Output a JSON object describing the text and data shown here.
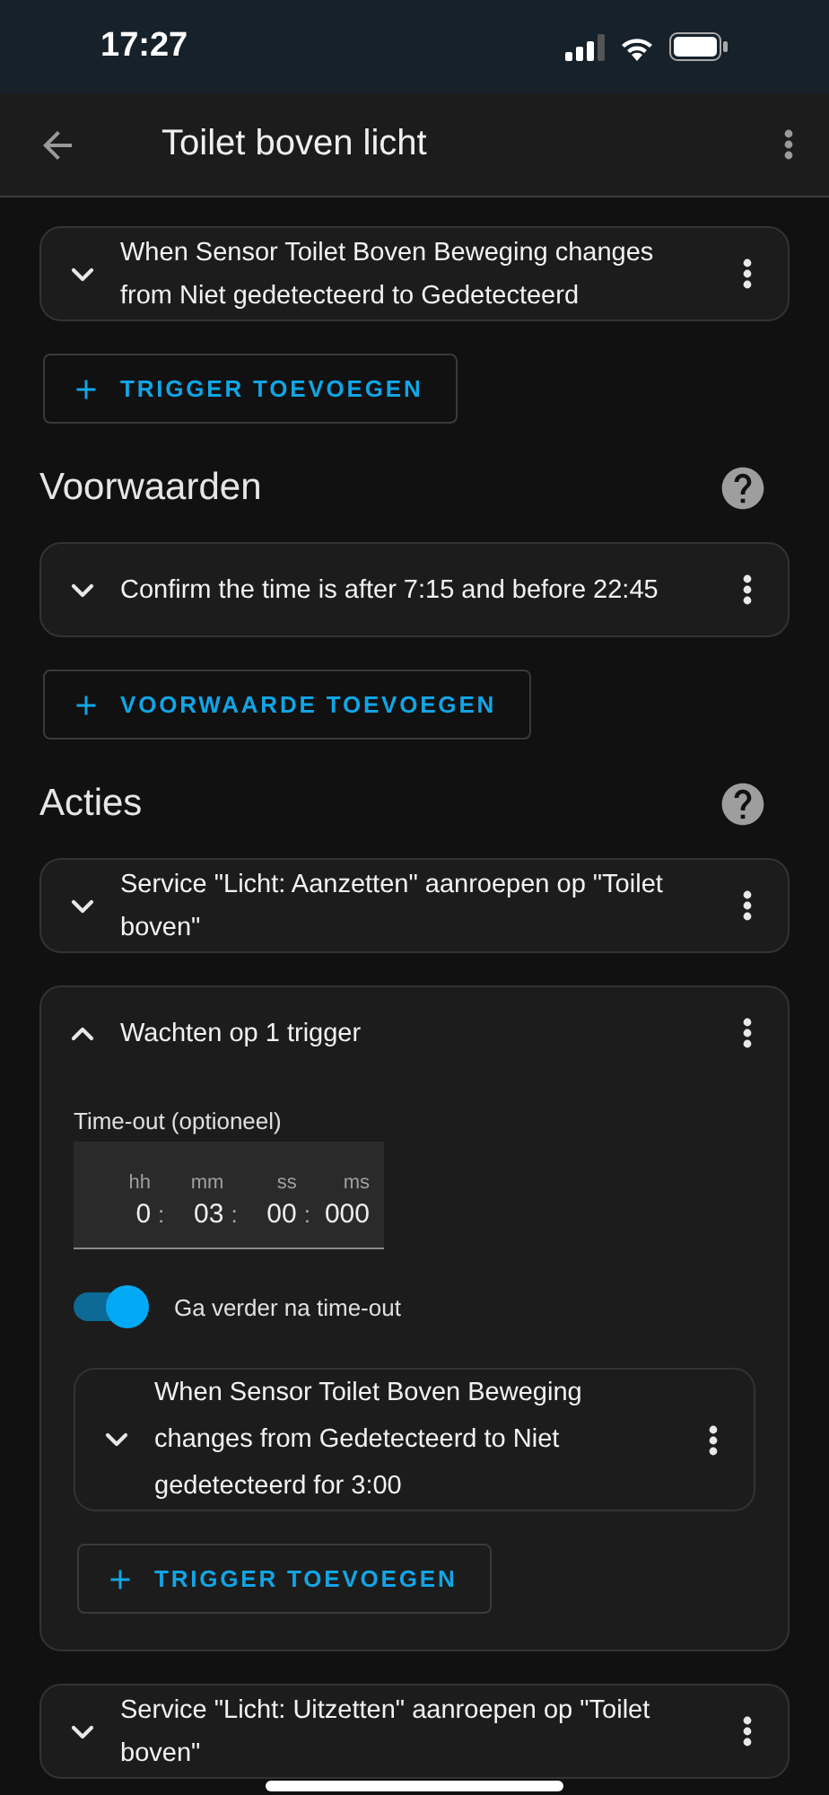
{
  "status_bar": {
    "time": "17:27"
  },
  "header": {
    "title": "Toilet boven licht"
  },
  "sections": [
    {
      "items": [
        {
          "kind": "row",
          "text": "When Sensor Toilet Boven Beweging changes from Niet gedetecteerd to Gedetecteerd",
          "expanded": false
        }
      ],
      "add_button": "TRIGGER TOEVOEGEN"
    },
    {
      "title": "Voorwaarden",
      "items": [
        {
          "kind": "row",
          "text": "Confirm the time is after 7:15 and before 22:45",
          "expanded": false
        }
      ],
      "add_button": "VOORWAARDE TOEVOEGEN"
    },
    {
      "title": "Acties",
      "items": [
        {
          "kind": "row",
          "text": "Service \"Licht: Aanzetten\" aanroepen op \"Toilet boven\"",
          "expanded": false
        },
        {
          "kind": "wait",
          "text": "Wachten op 1 trigger",
          "expanded": true,
          "timeout_label": "Time-out (optioneel)",
          "separator": ":",
          "units": [
            {
              "unit": "hh",
              "value": "0"
            },
            {
              "unit": "mm",
              "value": "03"
            },
            {
              "unit": "ss",
              "value": "00"
            },
            {
              "unit": "ms",
              "value": "000"
            }
          ],
          "continue": {
            "label": "Ga verder na time-out",
            "on": true
          },
          "triggers": [
            {
              "text": "When Sensor Toilet Boven Beweging changes from Gedetecteerd to Niet gedetecteerd for 3:00",
              "expanded": false
            }
          ],
          "add_button": "TRIGGER TOEVOEGEN"
        },
        {
          "kind": "row",
          "text": "Service \"Licht: Uitzetten\" aanroepen op \"Toilet boven\"",
          "expanded": false
        }
      ]
    }
  ]
}
